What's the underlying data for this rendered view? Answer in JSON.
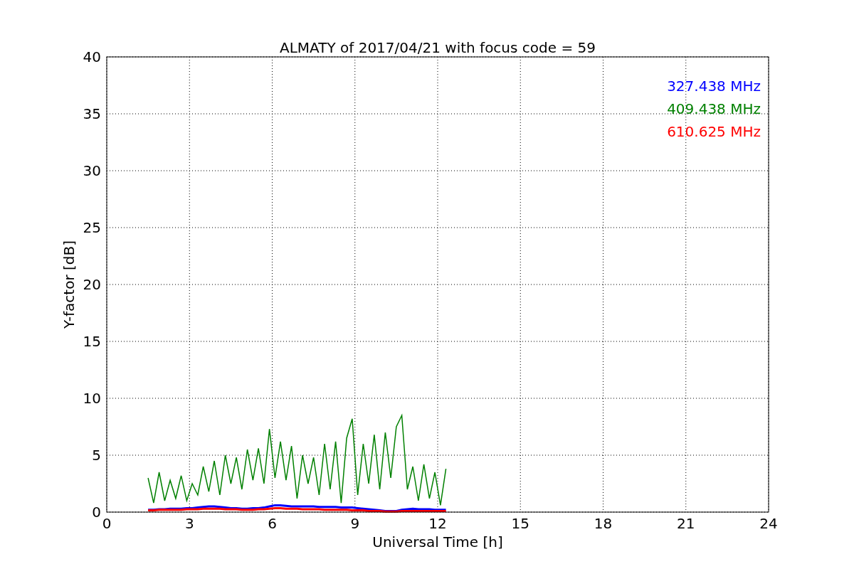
{
  "chart_data": {
    "type": "line",
    "title": "ALMATY of 2017/04/21 with focus code = 59",
    "xlabel": "Universal Time [h]",
    "ylabel": "Y-factor [dB]",
    "x": [
      1.5,
      1.7,
      1.9,
      2.1,
      2.3,
      2.5,
      2.7,
      2.9,
      3.1,
      3.3,
      3.5,
      3.7,
      3.9,
      4.1,
      4.3,
      4.5,
      4.7,
      4.9,
      5.1,
      5.3,
      5.5,
      5.7,
      5.9,
      6.1,
      6.3,
      6.5,
      6.7,
      6.9,
      7.1,
      7.3,
      7.5,
      7.7,
      7.9,
      8.1,
      8.3,
      8.5,
      8.7,
      8.9,
      9.1,
      9.3,
      9.5,
      9.7,
      9.9,
      10.1,
      10.3,
      10.5,
      10.7,
      10.9,
      11.1,
      11.3,
      11.5,
      11.7,
      11.9,
      12.1,
      12.3
    ],
    "series": [
      {
        "name": "327.438 MHz",
        "color": "#0000ff",
        "values": [
          0.2,
          0.2,
          0.25,
          0.25,
          0.3,
          0.3,
          0.3,
          0.35,
          0.35,
          0.4,
          0.45,
          0.5,
          0.5,
          0.45,
          0.4,
          0.35,
          0.35,
          0.3,
          0.3,
          0.35,
          0.35,
          0.4,
          0.5,
          0.6,
          0.6,
          0.55,
          0.5,
          0.5,
          0.5,
          0.5,
          0.5,
          0.45,
          0.45,
          0.45,
          0.45,
          0.4,
          0.4,
          0.4,
          0.35,
          0.3,
          0.25,
          0.2,
          0.15,
          0.1,
          0.1,
          0.1,
          0.2,
          0.25,
          0.3,
          0.25,
          0.25,
          0.25,
          0.2,
          0.2,
          0.2
        ]
      },
      {
        "name": "409.438 MHz",
        "color": "#008000",
        "values": [
          3.0,
          0.8,
          3.5,
          1.0,
          2.8,
          1.2,
          3.2,
          1.0,
          2.5,
          1.5,
          4.0,
          1.8,
          4.5,
          1.5,
          5.0,
          2.5,
          4.8,
          2.0,
          5.5,
          2.8,
          5.6,
          2.5,
          7.3,
          3.0,
          6.2,
          2.8,
          5.8,
          1.2,
          5.0,
          2.5,
          4.8,
          1.5,
          6.0,
          2.0,
          6.2,
          0.8,
          6.5,
          8.2,
          1.5,
          6.0,
          2.5,
          6.8,
          2.0,
          7.0,
          3.0,
          7.5,
          8.5,
          2.0,
          4.0,
          1.0,
          4.2,
          1.2,
          3.5,
          0.6,
          3.8
        ]
      },
      {
        "name": "610.625 MHz",
        "color": "#ff0000",
        "values": [
          0.15,
          0.15,
          0.2,
          0.2,
          0.2,
          0.2,
          0.2,
          0.25,
          0.25,
          0.25,
          0.3,
          0.3,
          0.3,
          0.3,
          0.25,
          0.25,
          0.25,
          0.2,
          0.2,
          0.2,
          0.25,
          0.25,
          0.3,
          0.35,
          0.35,
          0.3,
          0.3,
          0.3,
          0.25,
          0.25,
          0.25,
          0.25,
          0.2,
          0.2,
          0.2,
          0.2,
          0.2,
          0.15,
          0.15,
          0.15,
          0.1,
          0.1,
          0.1,
          0.05,
          0.05,
          0.05,
          0.1,
          0.1,
          0.1,
          0.1,
          0.1,
          0.1,
          0.1,
          0.1,
          0.1
        ]
      }
    ],
    "grid": true,
    "xlim": [
      0,
      24
    ],
    "ylim": [
      0,
      40
    ],
    "xticks": [
      0,
      3,
      6,
      9,
      12,
      15,
      18,
      21,
      24
    ],
    "yticks": [
      0,
      5,
      10,
      15,
      20,
      25,
      30,
      35,
      40
    ]
  }
}
